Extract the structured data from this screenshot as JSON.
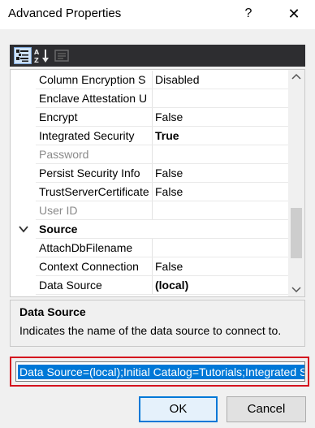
{
  "window": {
    "title": "Advanced Properties",
    "help_glyph": "?",
    "close_glyph": "✕"
  },
  "toolbar": {
    "buttons": [
      {
        "name": "categorized-view-icon",
        "selected": true
      },
      {
        "name": "alphabetical-sort-icon",
        "selected": false
      },
      {
        "name": "property-pages-icon",
        "selected": false,
        "enabled": false
      }
    ]
  },
  "grid": {
    "rows": [
      {
        "type": "property",
        "name": "Column Encryption S",
        "value": "Disabled",
        "bold": false,
        "disabled": false
      },
      {
        "type": "property",
        "name": "Enclave Attestation U",
        "value": "",
        "bold": false,
        "disabled": false
      },
      {
        "type": "property",
        "name": "Encrypt",
        "value": "False",
        "bold": false,
        "disabled": false
      },
      {
        "type": "property",
        "name": "Integrated Security",
        "value": "True",
        "bold": true,
        "disabled": false
      },
      {
        "type": "property",
        "name": "Password",
        "value": "",
        "bold": false,
        "disabled": true
      },
      {
        "type": "property",
        "name": "Persist Security Info",
        "value": "False",
        "bold": false,
        "disabled": false
      },
      {
        "type": "property",
        "name": "TrustServerCertificate",
        "value": "False",
        "bold": false,
        "disabled": false
      },
      {
        "type": "property",
        "name": "User ID",
        "value": "",
        "bold": false,
        "disabled": true
      },
      {
        "type": "category",
        "name": "Source",
        "expanded": true
      },
      {
        "type": "property",
        "name": "AttachDbFilename",
        "value": "",
        "bold": false,
        "disabled": false
      },
      {
        "type": "property",
        "name": "Context Connection",
        "value": "False",
        "bold": false,
        "disabled": false
      },
      {
        "type": "property",
        "name": "Data Source",
        "value": "(local)",
        "bold": true,
        "disabled": false,
        "selected": true
      }
    ]
  },
  "description": {
    "title": "Data Source",
    "text": "Indicates the name of the data source to connect to."
  },
  "connection_string": {
    "value": "Data Source=(local);Initial Catalog=Tutorials;Integrated Security=True"
  },
  "buttons": {
    "ok_label": "OK",
    "cancel_label": "Cancel"
  },
  "colors": {
    "highlight_frame": "#d4131e",
    "selection": "#0078d7",
    "toolbar_bg": "#2d2d30"
  }
}
